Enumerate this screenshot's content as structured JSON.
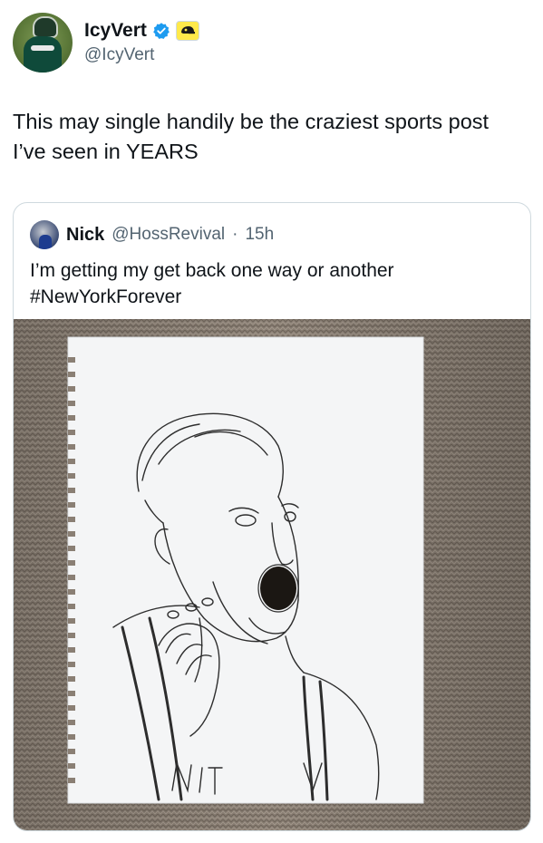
{
  "tweet": {
    "author": {
      "name": "IcyVert",
      "handle": "@IcyVert"
    },
    "text": "This may single handily be the craziest sports post I’ve seen in YEARS"
  },
  "quoted_tweet": {
    "author": {
      "name": "Nick",
      "handle": "@HossRevival"
    },
    "separator": "·",
    "time": "15h",
    "text_line1": "I’m getting my get back one way or another",
    "text_line2": "#NewYorkForever"
  },
  "icons": {
    "verified": "verified-badge-icon",
    "affiliate": "affiliate-badge-icon"
  },
  "colors": {
    "verified": "#1d9bf0",
    "secondary_text": "#536471",
    "border": "#cfd9de"
  }
}
